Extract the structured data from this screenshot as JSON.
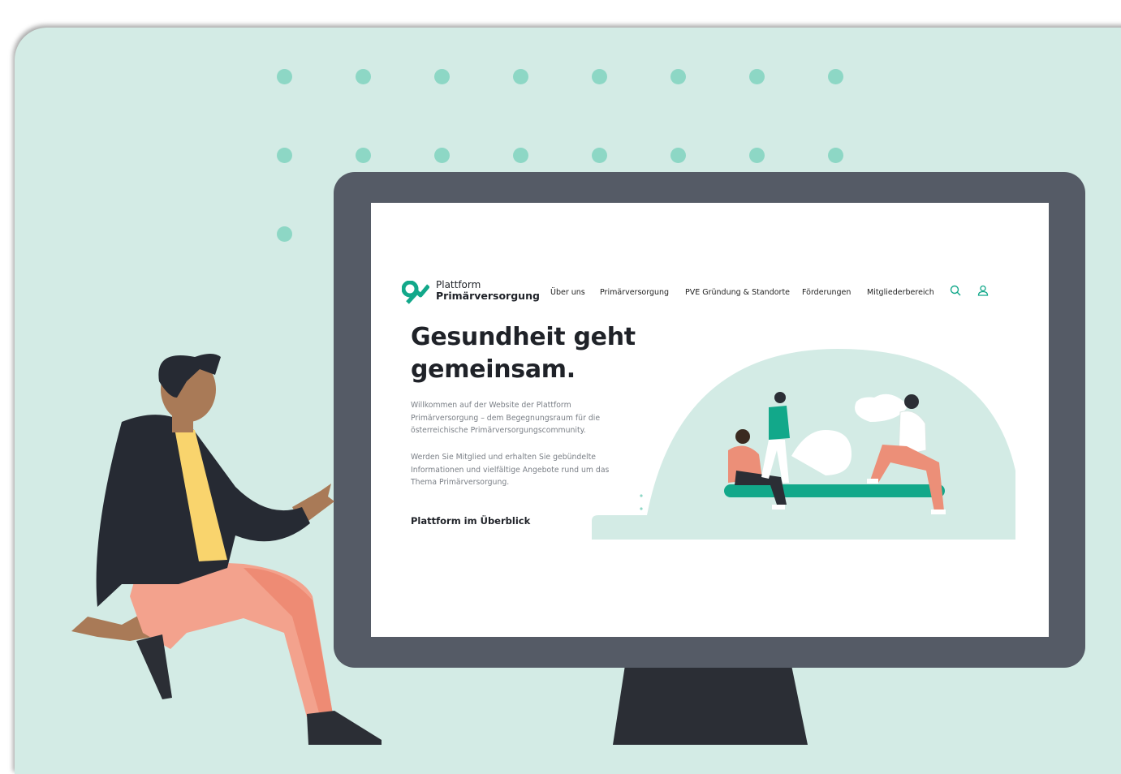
{
  "site": {
    "logo": {
      "line1": "Plattform",
      "line2": "Primärversorgung",
      "icon": "plattform-logo-icon"
    },
    "nav": [
      "Über uns",
      "Primärversorgung",
      "PVE Gründung & Standorte",
      "Förderungen",
      "Mitgliederbereich"
    ],
    "icons": {
      "search": "search-icon",
      "user": "user-icon"
    },
    "hero": {
      "title_line1": "Gesundheit geht",
      "title_line2": "gemeinsam.",
      "paragraph1_lines": [
        "Willkommen auf der Website der Plattform",
        "Primärversorgung – dem Begegnungsraum für die",
        "österreichische Primärversorgungscommunity."
      ],
      "paragraph2_lines": [
        "Werden Sie Mitglied und erhalten Sie gebündelte",
        "Informationen und vielfältige Angebote rund um das",
        "Thema Primärversorgung."
      ],
      "cta": "Plattform im Überblick"
    }
  },
  "colors": {
    "background": "#d3ebe5",
    "accent": "#12a88a",
    "monitor": "#555b66",
    "dots": "#8dd7c5",
    "text": "#1f2228"
  }
}
